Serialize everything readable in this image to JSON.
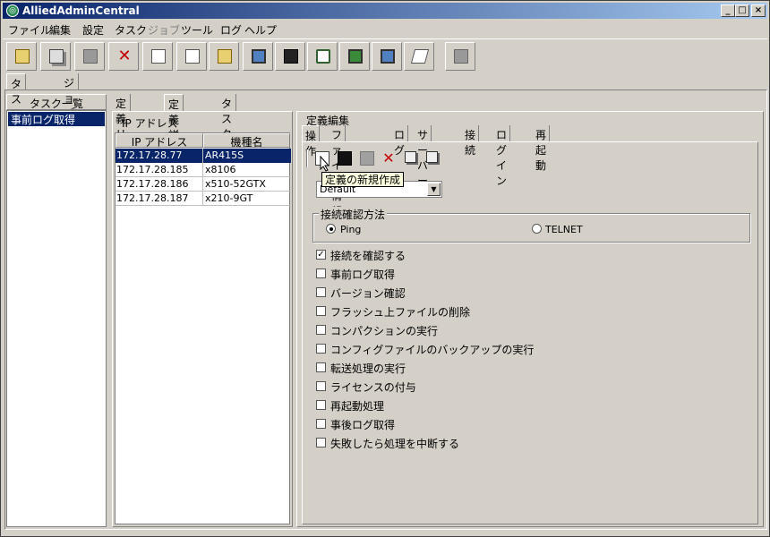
{
  "window": {
    "title": "AlliedAdminCentral",
    "minimize": "_",
    "maximize": "□",
    "close": "×"
  },
  "menu": [
    "ファイル",
    "編集",
    "設定",
    "タスク",
    "ジョブ",
    "ツール",
    "ログ",
    "ヘルプ"
  ],
  "outer_tabs": [
    "タスクリスト",
    "ジョブリスト"
  ],
  "side": {
    "header": "タスク一覧",
    "items": [
      "事前ログ取得"
    ]
  },
  "inner_tabs": [
    "定義リスト",
    "定義詳細",
    "タスク情報"
  ],
  "ip_panel": {
    "caption": "IP アドレス",
    "columns": [
      "IP アドレス",
      "機種名"
    ],
    "rows": [
      [
        "172.17.28.77",
        "AR415S"
      ],
      [
        "172.17.28.185",
        "x8106"
      ],
      [
        "172.17.28.186",
        "x510-52GTX"
      ],
      [
        "172.17.28.187",
        "x210-9GT"
      ]
    ]
  },
  "definition": {
    "caption": "定義編集",
    "tabs": [
      "操作",
      "ファイル情報",
      "ログ",
      "サーバー",
      "接続",
      "ログイン",
      "再起動"
    ],
    "tooltip": "定義の新規作成",
    "profile_value": "Default",
    "connection_group": "接続確認方法",
    "radio_ping": "Ping",
    "radio_telnet": "TELNET",
    "checkboxes": [
      {
        "label": "接続を確認する",
        "checked": true
      },
      {
        "label": "事前ログ取得",
        "checked": false
      },
      {
        "label": "バージョン確認",
        "checked": false
      },
      {
        "label": "フラッシュ上ファイルの削除",
        "checked": false
      },
      {
        "label": "コンパクションの実行",
        "checked": false
      },
      {
        "label": "コンフィグファイルのバックアップの実行",
        "checked": false
      },
      {
        "label": "転送処理の実行",
        "checked": false
      },
      {
        "label": "ライセンスの付与",
        "checked": false
      },
      {
        "label": "再起動処理",
        "checked": false
      },
      {
        "label": "事後ログ取得",
        "checked": false
      },
      {
        "label": "失敗したら処理を中断する",
        "checked": false
      }
    ]
  },
  "colors": {
    "selection": "#0a246a",
    "face": "#d4d0c8",
    "tooltip": "#ffffe1"
  }
}
